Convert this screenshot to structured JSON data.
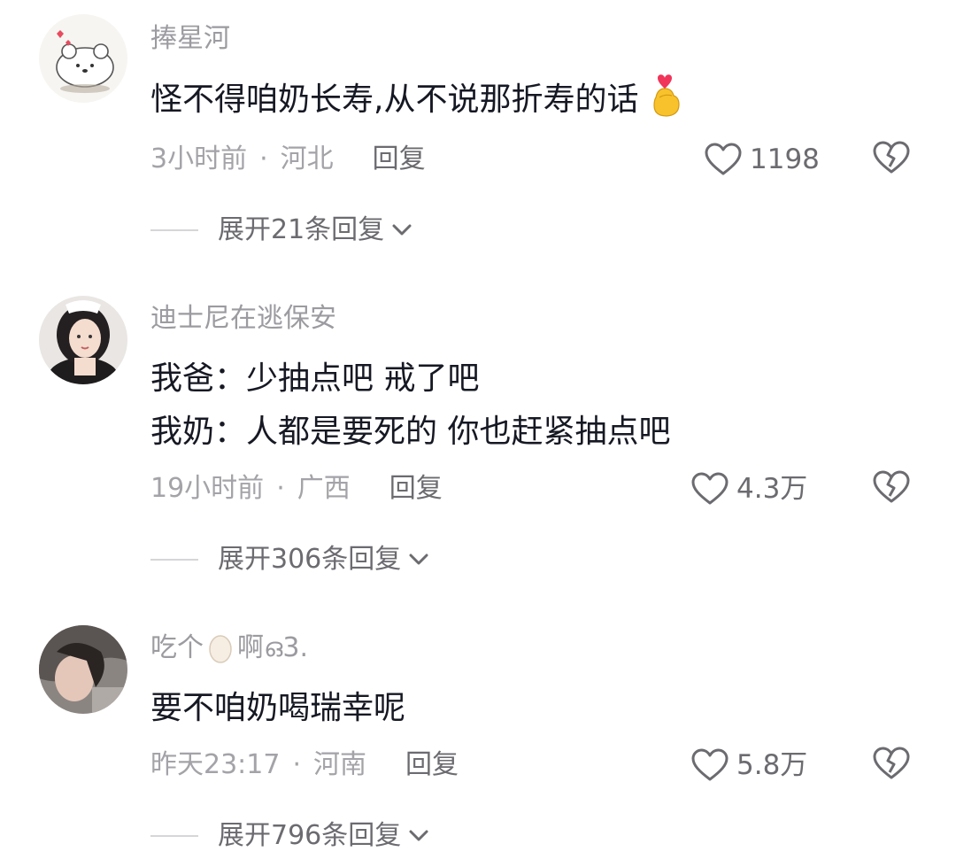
{
  "comments": [
    {
      "username": "捧星河",
      "lines": [
        "怪不得咱奶长寿,从不说那折寿的话"
      ],
      "emoji": "finger-heart-emoji",
      "time": "3小时前",
      "location": "河北",
      "reply_label": "回复",
      "likes": "1198",
      "expand_label": "展开21条回复"
    },
    {
      "username": "迪士尼在逃保安",
      "lines": [
        "我爸：少抽点吧 戒了吧",
        "我奶：人都是要死的 你也赶紧抽点吧"
      ],
      "time": "19小时前",
      "location": "广西",
      "reply_label": "回复",
      "likes": "4.3万",
      "expand_label": "展开306条回复"
    },
    {
      "username_before": "吃个",
      "username_emoji": "egg-emoji",
      "username_after": "啊ഒ3.",
      "lines": [
        "要不咱奶喝瑞幸呢"
      ],
      "time": "昨天23:17",
      "location": "河南",
      "reply_label": "回复",
      "likes": "5.8万",
      "expand_label": "展开796条回复"
    }
  ],
  "meta_separator": "·",
  "icons": {
    "like": "heart-outline-icon",
    "dislike": "broken-heart-icon",
    "expand": "chevron-down-icon"
  },
  "colors": {
    "text_primary": "#161823",
    "text_secondary": "#a3a3a8",
    "icon": "#6b6b70"
  }
}
